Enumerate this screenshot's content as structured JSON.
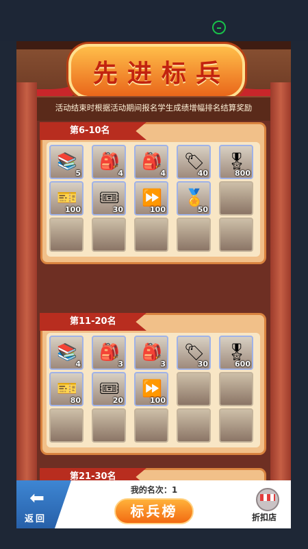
{
  "header": {
    "title": "先进标兵",
    "notice": "活动结束时根据活动期间报名学生成绩增幅排名结算奖励"
  },
  "sections": [
    {
      "rank_label": "第6-10名",
      "rows": [
        [
          {
            "icon": "book-stack-icon",
            "glyph": "📚",
            "qty": "5"
          },
          {
            "icon": "blue-backpack-icon",
            "glyph": "🎒",
            "qty": "4"
          },
          {
            "icon": "pink-backpack-icon",
            "glyph": "🎒",
            "qty": "4"
          },
          {
            "icon": "bookmark-tag-icon",
            "glyph": "🏷",
            "qty": "40"
          },
          {
            "icon": "red-medal-icon",
            "glyph": "🎖",
            "qty": "800"
          }
        ],
        [
          {
            "icon": "blue-ticket-icon",
            "glyph": "🎫",
            "qty": "100"
          },
          {
            "icon": "gold-ticket-icon",
            "glyph": "🎟",
            "qty": "30"
          },
          {
            "icon": "fast-forward-icon",
            "glyph": "⏩",
            "qty": "100"
          },
          {
            "icon": "gold-badge-icon",
            "glyph": "🏅",
            "qty": "50"
          },
          {
            "icon": "empty-slot",
            "glyph": "",
            "qty": ""
          }
        ],
        [
          {
            "icon": "empty-slot",
            "glyph": "",
            "qty": ""
          },
          {
            "icon": "empty-slot",
            "glyph": "",
            "qty": ""
          },
          {
            "icon": "empty-slot",
            "glyph": "",
            "qty": ""
          },
          {
            "icon": "empty-slot",
            "glyph": "",
            "qty": ""
          },
          {
            "icon": "empty-slot",
            "glyph": "",
            "qty": ""
          }
        ]
      ]
    },
    {
      "rank_label": "第11-20名",
      "rows": [
        [
          {
            "icon": "book-stack-icon",
            "glyph": "📚",
            "qty": "4"
          },
          {
            "icon": "blue-backpack-icon",
            "glyph": "🎒",
            "qty": "3"
          },
          {
            "icon": "pink-backpack-icon",
            "glyph": "🎒",
            "qty": "3"
          },
          {
            "icon": "bookmark-tag-icon",
            "glyph": "🏷",
            "qty": "30"
          },
          {
            "icon": "red-medal-icon",
            "glyph": "🎖",
            "qty": "600"
          }
        ],
        [
          {
            "icon": "blue-ticket-icon",
            "glyph": "🎫",
            "qty": "80"
          },
          {
            "icon": "gold-ticket-icon",
            "glyph": "🎟",
            "qty": "20"
          },
          {
            "icon": "fast-forward-icon",
            "glyph": "⏩",
            "qty": "100"
          },
          {
            "icon": "empty-slot",
            "glyph": "",
            "qty": ""
          },
          {
            "icon": "empty-slot",
            "glyph": "",
            "qty": ""
          }
        ],
        [
          {
            "icon": "empty-slot",
            "glyph": "",
            "qty": ""
          },
          {
            "icon": "empty-slot",
            "glyph": "",
            "qty": ""
          },
          {
            "icon": "empty-slot",
            "glyph": "",
            "qty": ""
          },
          {
            "icon": "empty-slot",
            "glyph": "",
            "qty": ""
          },
          {
            "icon": "empty-slot",
            "glyph": "",
            "qty": ""
          }
        ]
      ]
    },
    {
      "rank_label": "第21-30名",
      "rows": [
        [
          {
            "icon": "book-stack-icon",
            "glyph": "📚",
            "qty": ""
          },
          {
            "icon": "blue-backpack-icon",
            "glyph": "🎒",
            "qty": ""
          },
          {
            "icon": "pink-backpack-icon",
            "glyph": "🎒",
            "qty": ""
          },
          {
            "icon": "bookmark-tag-icon",
            "glyph": "🏷",
            "qty": ""
          },
          {
            "icon": "red-medal-icon",
            "glyph": "🎖",
            "qty": ""
          }
        ]
      ]
    }
  ],
  "footer": {
    "back_label": "返回",
    "my_rank": "我的名次：1",
    "rank_button": "标兵榜",
    "shop_label": "折扣店"
  },
  "colors": {
    "accent": "#f26a12",
    "ribbon": "#b82d1f",
    "panel": "#f1c089"
  }
}
